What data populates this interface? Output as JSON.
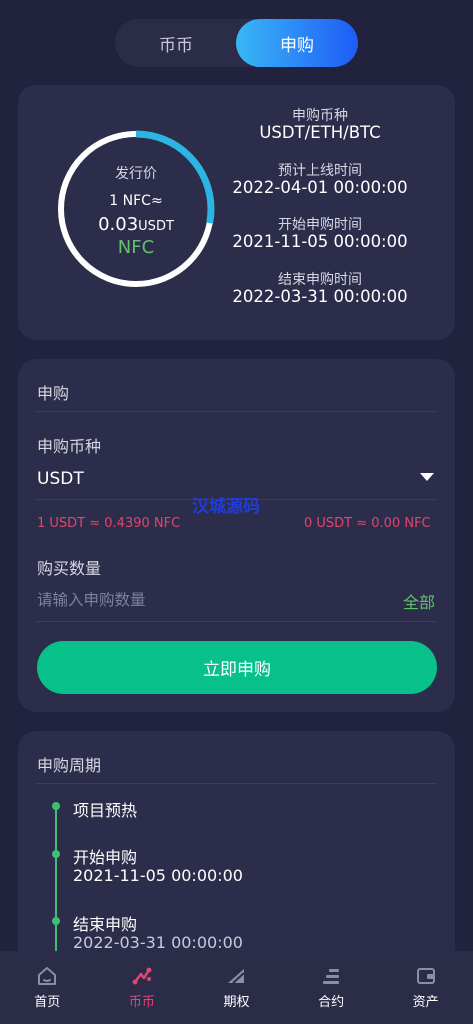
{
  "toggle": {
    "left": "币币",
    "right": "申购"
  },
  "info": {
    "ring_title": "发行价",
    "ring_line1": "1 NFC≈",
    "ring_price": "0.03",
    "ring_price_unit": "USDT",
    "ring_coin": "NFC",
    "ring_progress": 0.28,
    "currency_label": "申购币种",
    "currency_value": "USDT/ETH/BTC",
    "listing_label": "预计上线时间",
    "listing_value": "2022-04-01 00:00:00",
    "start_label": "开始申购时间",
    "start_value": "2021-11-05 00:00:00",
    "end_label": "结束申购时间",
    "end_value": "2022-03-31 00:00:00"
  },
  "subscribe": {
    "title": "申购",
    "currency_label": "申购币种",
    "currency_selected": "USDT",
    "rate_left": "1 USDT ≈ 0.4390 NFC",
    "rate_right": "0 USDT ≈ 0.00 NFC",
    "amount_label": "购买数量",
    "amount_placeholder": "请输入申购数量",
    "all_label": "全部",
    "submit_label": "立即申购"
  },
  "watermark": "汉城源码",
  "period": {
    "title": "申购周期",
    "steps": [
      {
        "name": "项目预热",
        "time": ""
      },
      {
        "name": "开始申购",
        "time": "2021-11-05 00:00:00"
      },
      {
        "name": "结束申购",
        "time": "2022-03-31 00:00:00"
      }
    ]
  },
  "nav": {
    "items": [
      {
        "label": "首页",
        "icon": "home-icon"
      },
      {
        "label": "币币",
        "icon": "exchange-icon",
        "active": true
      },
      {
        "label": "期权",
        "icon": "options-icon"
      },
      {
        "label": "合约",
        "icon": "contract-icon"
      },
      {
        "label": "资产",
        "icon": "wallet-icon"
      }
    ]
  },
  "colors": {
    "background": "#21223d",
    "card": "#2c2d4a",
    "accent_green": "#07c08a",
    "rate_red": "#e0456e",
    "ring_blue": "#2cb5e3",
    "nav_active": "#e24474"
  }
}
